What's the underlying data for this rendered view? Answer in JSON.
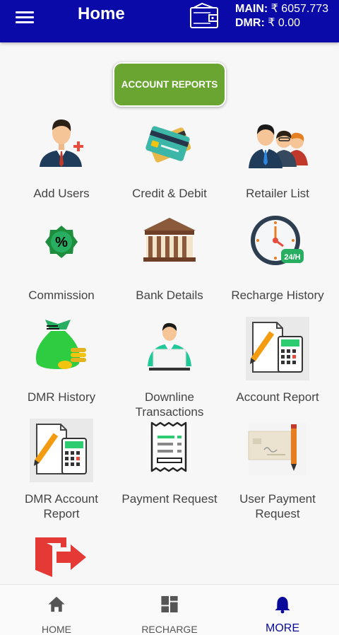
{
  "header": {
    "title": "Home",
    "main_label": "MAIN:",
    "main_value": "₹ 6057.773",
    "dmr_label": "DMR:",
    "dmr_value": "₹ 0.00",
    "color": "#0a0aa8"
  },
  "account_reports_button": {
    "label": "ACCOUNT REPORTS",
    "color": "#6aa531"
  },
  "tiles": [
    {
      "label": "Add Users",
      "icon": "add-user-icon"
    },
    {
      "label": "Credit & Debit",
      "icon": "credit-card-icon"
    },
    {
      "label": "Retailer List",
      "icon": "people-group-icon"
    },
    {
      "label": "Commission",
      "icon": "percent-badge-icon"
    },
    {
      "label": "Bank Details",
      "icon": "bank-icon"
    },
    {
      "label": "Recharge History",
      "icon": "clock-24h-icon"
    },
    {
      "label": "DMR History",
      "icon": "money-bag-icon"
    },
    {
      "label": "Downline Transactions",
      "icon": "person-laptop-icon"
    },
    {
      "label": "Account Report",
      "icon": "calculator-report-icon"
    },
    {
      "label": "DMR Account Report",
      "icon": "calculator-report-icon"
    },
    {
      "label": "Payment Request",
      "icon": "receipt-icon"
    },
    {
      "label": "User Payment Request",
      "icon": "cheque-pencil-icon"
    },
    {
      "label": "",
      "icon": "logout-icon"
    }
  ],
  "bottom_nav": [
    {
      "label": "HOME",
      "icon": "home-icon"
    },
    {
      "label": "RECHARGE",
      "icon": "grid-icon"
    },
    {
      "label": "MORE",
      "icon": "bell-icon",
      "active": true
    }
  ]
}
